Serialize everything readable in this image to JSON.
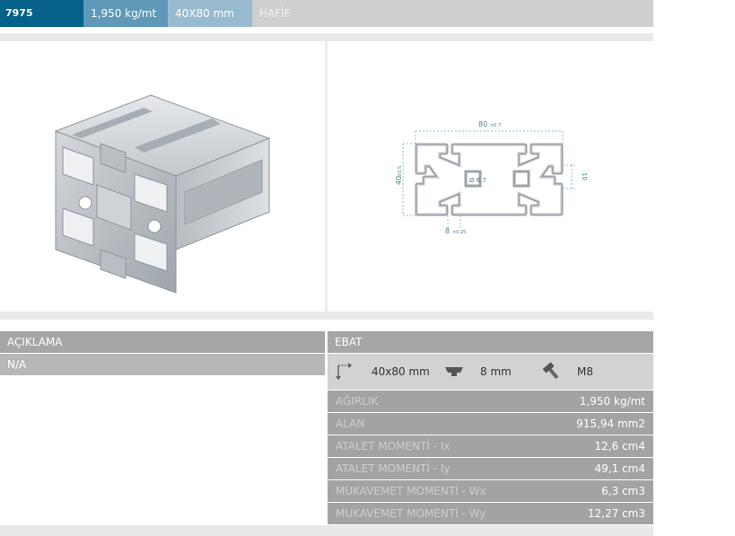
{
  "header": {
    "code": "7975",
    "weight": "1,950 kg/mt",
    "size": "40X80 mm",
    "type": "HAFİF"
  },
  "drawing": {
    "width_label": "80",
    "width_tol": "±0.7",
    "height_label": "40",
    "height_tol": "±0.5",
    "bore_label": "Ø 6.7",
    "slot_side_label": "10",
    "slot_label": "8",
    "slot_tol": "±0.25"
  },
  "description": {
    "heading": "AÇIKLAMA",
    "value": "N/A"
  },
  "dimensions": {
    "heading": "EBAT",
    "size": "40x80 mm",
    "slot": "8 mm",
    "bolt": "M8"
  },
  "specs": [
    {
      "label": "AĞIRLIK",
      "value": "1,950 kg/mt"
    },
    {
      "label": "ALAN",
      "value": "915,94 mm2"
    },
    {
      "label": "ATALET MOMENTİ - Ix",
      "value": "12,6 cm4"
    },
    {
      "label": "ATALET MOMENTİ - Iy",
      "value": "49,1 cm4"
    },
    {
      "label": "MUKAVEMET MOMENTİ - Wx",
      "value": "6,3 cm3"
    },
    {
      "label": "MUKAVEMET MOMENTİ - Wy",
      "value": "12,27 cm3"
    }
  ],
  "colors": {
    "code_bg": "#06618a",
    "weight_bg": "#5f98b8",
    "size_bg": "#98bbd0",
    "bar_bg": "#cfcfd0",
    "dimension_line": "#6ab0b0"
  },
  "icons": [
    "dimension-arrows-icon",
    "t-slot-icon",
    "bolt-icon"
  ]
}
